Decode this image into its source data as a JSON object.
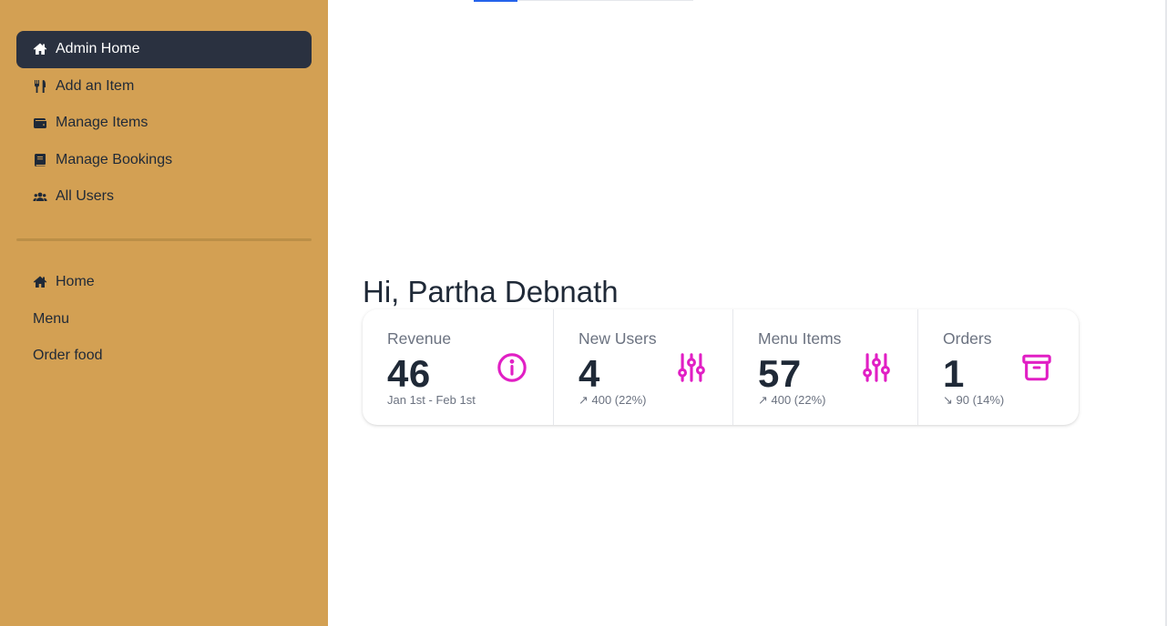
{
  "sidebar": {
    "primary": [
      {
        "label": "Admin Home",
        "icon": "home-icon"
      },
      {
        "label": "Add an Item",
        "icon": "utensils-icon"
      },
      {
        "label": "Manage Items",
        "icon": "wallet-icon"
      },
      {
        "label": "Manage Bookings",
        "icon": "book-icon"
      },
      {
        "label": "All Users",
        "icon": "users-icon"
      }
    ],
    "secondary": [
      {
        "label": "Home",
        "icon": "home-icon"
      },
      {
        "label": "Menu"
      },
      {
        "label": "Order food"
      }
    ]
  },
  "main": {
    "greeting": "Hi, Partha Debnath",
    "stats": [
      {
        "title": "Revenue",
        "value": "46",
        "desc": "Jan 1st - Feb 1st",
        "icon": "info-icon"
      },
      {
        "title": "New Users",
        "value": "4",
        "desc": "↗︎ 400 (22%)",
        "icon": "sliders-icon"
      },
      {
        "title": "Menu Items",
        "value": "57",
        "desc": "↗︎ 400 (22%)",
        "icon": "sliders-icon"
      },
      {
        "title": "Orders",
        "value": "1",
        "desc": "↘︎ 90 (14%)",
        "icon": "archive-icon"
      }
    ]
  },
  "colors": {
    "sidebar_bg": "#d3a053",
    "active_bg": "#2a3140",
    "accent": "#e11fc4"
  }
}
